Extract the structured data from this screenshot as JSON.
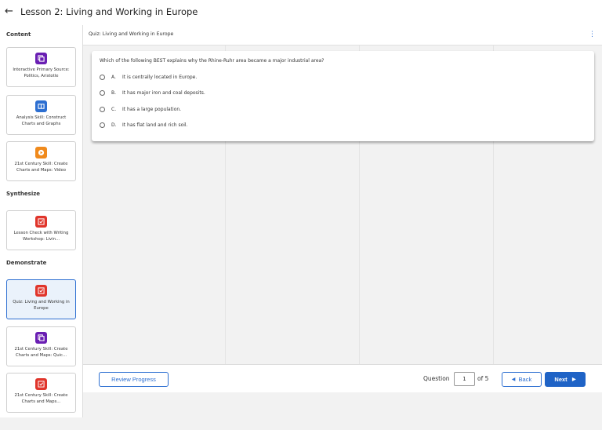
{
  "header": {
    "back_icon": "arrow-left-icon",
    "title": "Lesson 2: Living and Working in Europe"
  },
  "sidebar": {
    "content_heading": "Content",
    "synthesize_heading": "Synthesize",
    "demonstrate_heading": "Demonstrate",
    "cards": [
      {
        "label": "Interactive Primary Source: Politics, Aristotle",
        "icon": "copy-icon",
        "color": "#6a1fb3"
      },
      {
        "label": "Analysis Skill: Construct Charts and Graphs",
        "icon": "book-icon",
        "color": "#2d6fd1"
      },
      {
        "label": "21st Century Skill: Create Charts and Maps: Video",
        "icon": "play-icon",
        "color": "#f08a1c"
      },
      {
        "label": "Lesson Check with Writing Workshop: Livin...",
        "icon": "edit-check-icon",
        "color": "#e0352b"
      },
      {
        "label": "Quiz: Living and Working in Europe",
        "icon": "edit-check-icon",
        "color": "#e0352b"
      },
      {
        "label": "21st Century Skill: Create Charts and Maps: Quic...",
        "icon": "copy-icon",
        "color": "#6a1fb3"
      },
      {
        "label": "21st Century Skill: Create Charts and Maps...",
        "icon": "edit-check-icon",
        "color": "#e0352b"
      }
    ]
  },
  "quiz": {
    "title": "Quiz: Living and Working in Europe",
    "menu_icon": "more-vertical-icon",
    "question": "Which of the following BEST explains why the Rhine-Ruhr area became a major industrial area?",
    "options": [
      {
        "letter": "A.",
        "text": "It is centrally located in Europe."
      },
      {
        "letter": "B.",
        "text": "It has major iron and coal deposits."
      },
      {
        "letter": "C.",
        "text": "It has a large population."
      },
      {
        "letter": "D.",
        "text": "It has flat land and rich soil."
      }
    ]
  },
  "footer": {
    "review_label": "Review Progress",
    "question_label": "Question",
    "current_question": "1",
    "of_label": "of 5",
    "back_label": "Back",
    "next_label": "Next"
  }
}
